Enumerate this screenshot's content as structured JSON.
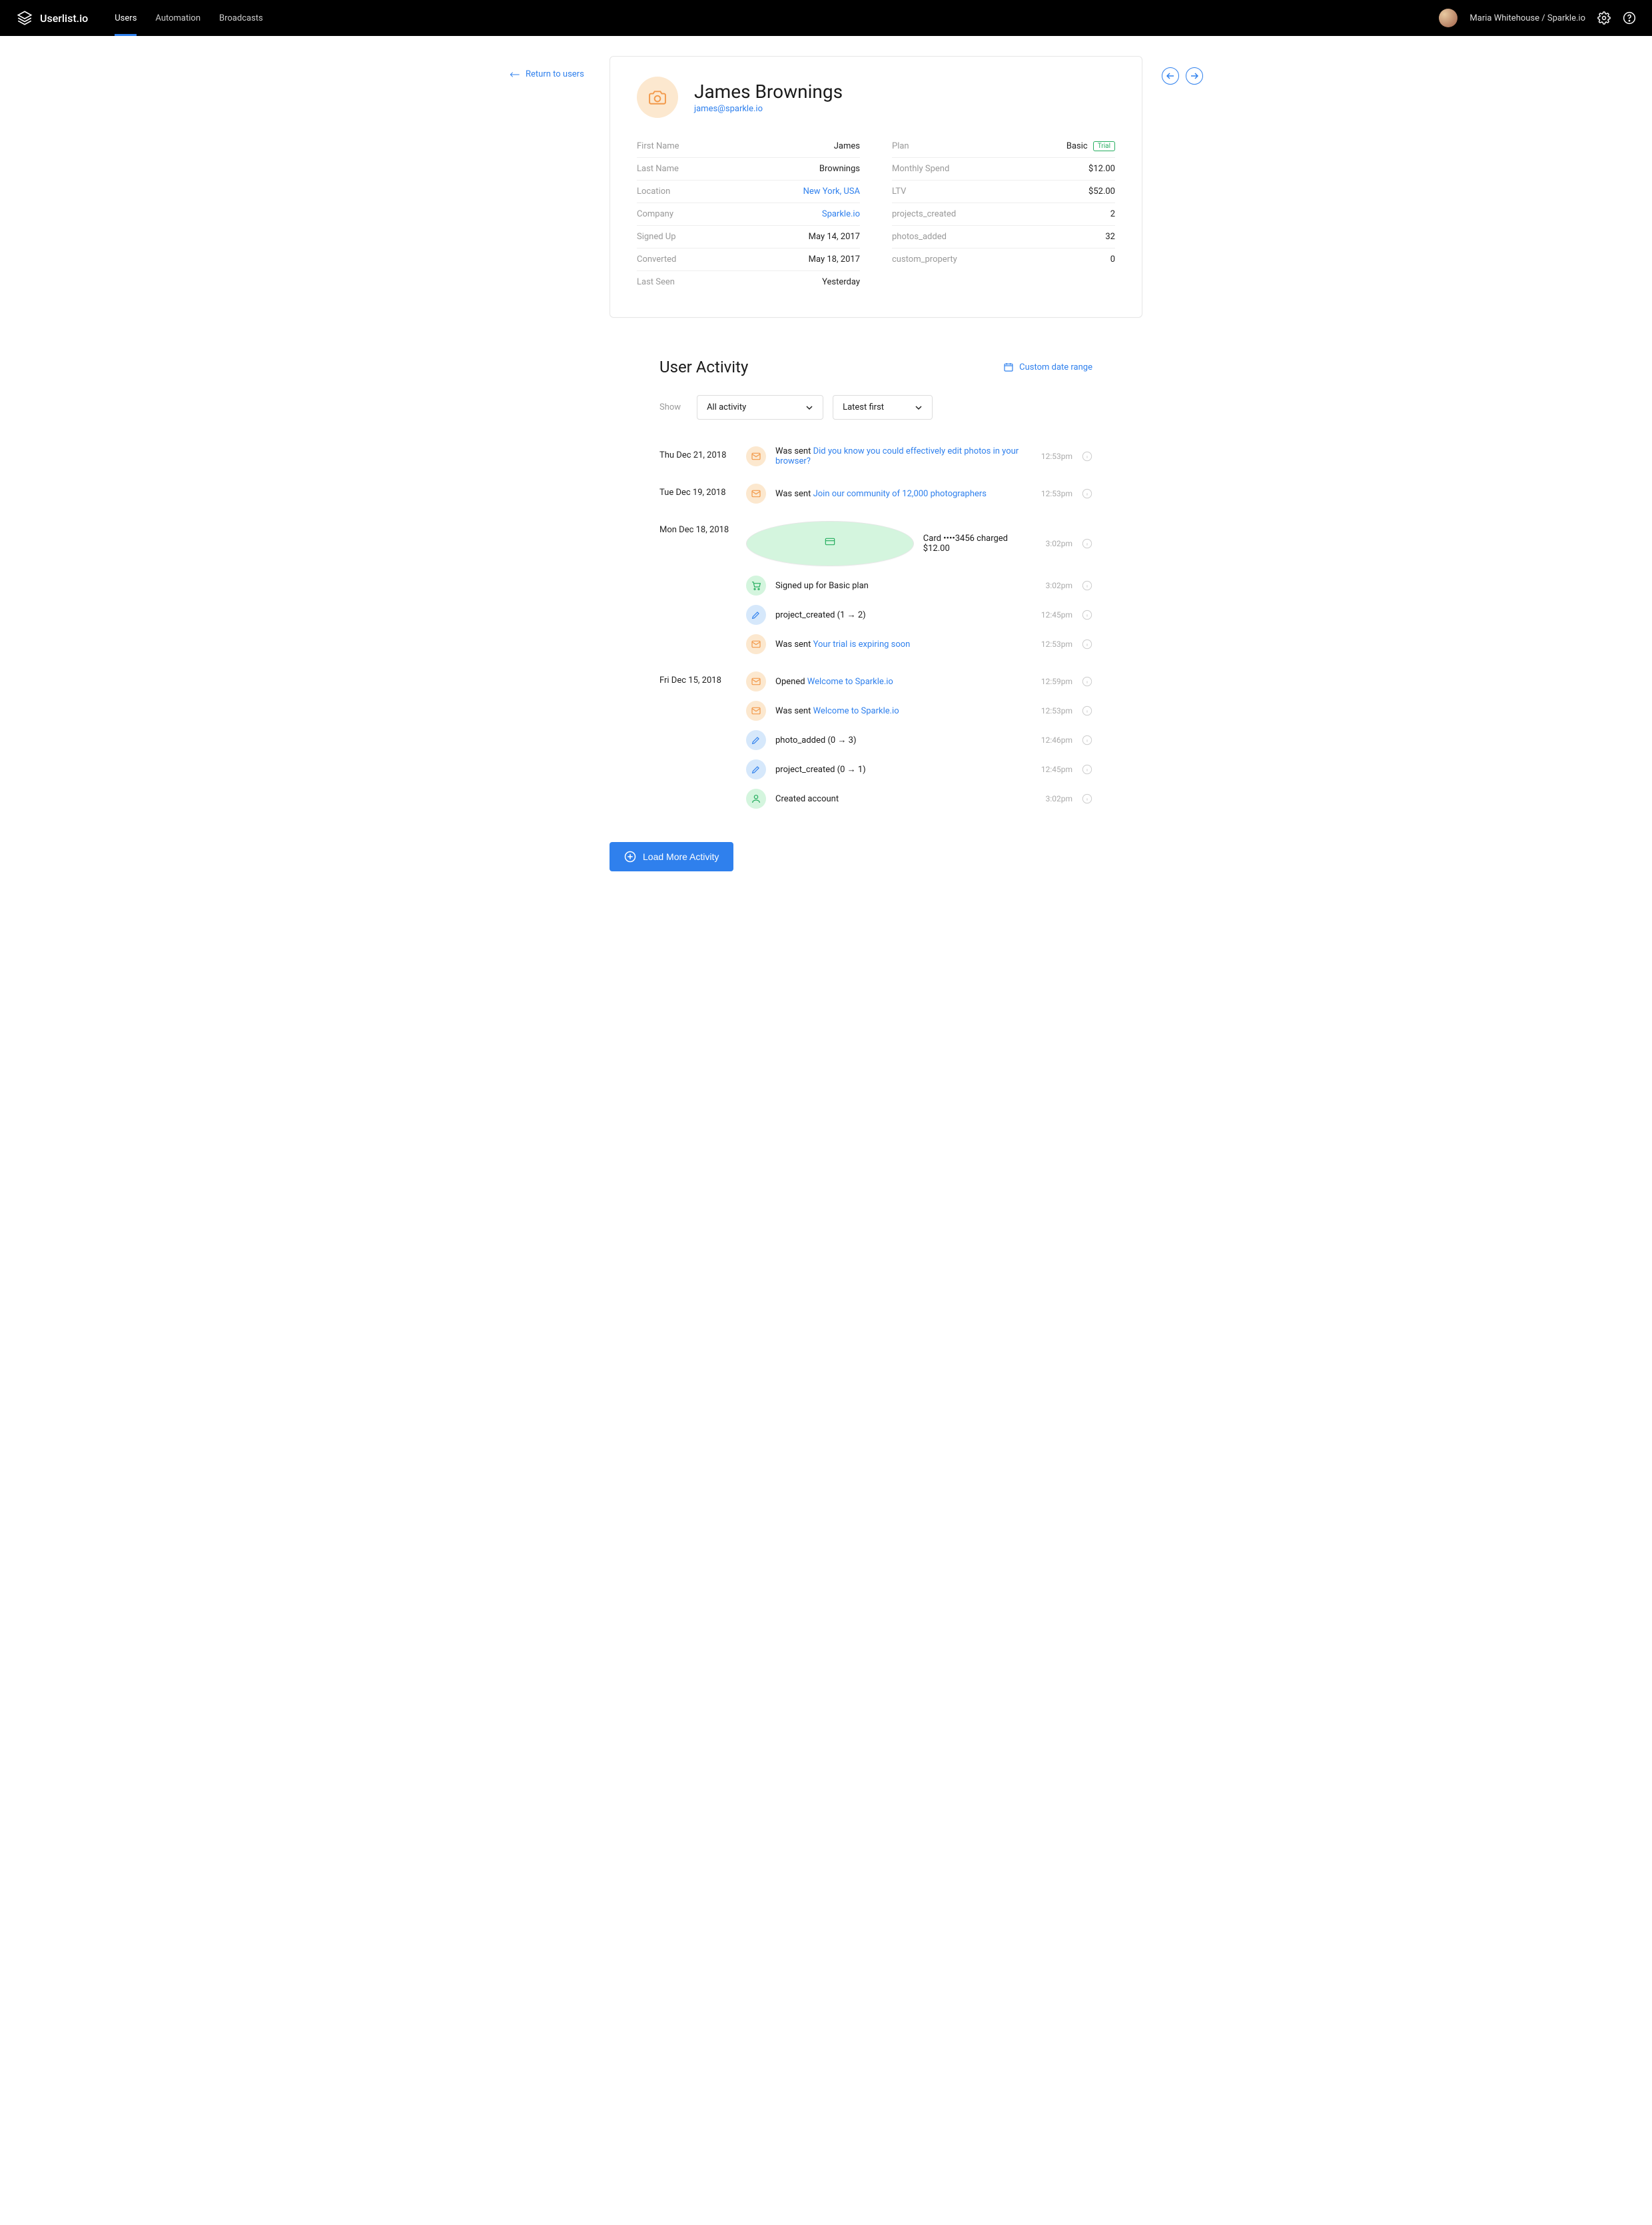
{
  "app": {
    "name": "Userlist.io"
  },
  "nav": {
    "users": "Users",
    "automation": "Automation",
    "broadcasts": "Broadcasts"
  },
  "account": {
    "name": "Maria Whitehouse / Sparkle.io"
  },
  "return_link": "Return to users",
  "profile": {
    "name": "James Brownings",
    "email": "james@sparkle.io",
    "left": {
      "first_name_label": "First Name",
      "first_name_value": "James",
      "last_name_label": "Last Name",
      "last_name_value": "Brownings",
      "location_label": "Location",
      "location_value": "New York, USA",
      "company_label": "Company",
      "company_value": "Sparkle.io",
      "signed_up_label": "Signed Up",
      "signed_up_value": "May 14, 2017",
      "converted_label": "Converted",
      "converted_value": "May 18, 2017",
      "last_seen_label": "Last Seen",
      "last_seen_value": "Yesterday"
    },
    "right": {
      "plan_label": "Plan",
      "plan_value": "Basic",
      "plan_badge": "Trial",
      "monthly_spend_label": "Monthly Spend",
      "monthly_spend_value": "$12.00",
      "ltv_label": "LTV",
      "ltv_value": "$52.00",
      "projects_created_label": "projects_created",
      "projects_created_value": "2",
      "photos_added_label": "photos_added",
      "photos_added_value": "32",
      "custom_property_label": "custom_property",
      "custom_property_value": "0"
    }
  },
  "activity": {
    "title": "User Activity",
    "date_range": "Custom date range",
    "show_label": "Show",
    "filter_type": "All activity",
    "filter_order": "Latest first",
    "days": [
      {
        "date": "Thu Dec 21, 2018",
        "events": [
          {
            "icon": "mail",
            "prefix": "Was sent",
            "link": "Did you know you could effectively edit photos in your browser?",
            "time": "12:53pm"
          }
        ]
      },
      {
        "date": "Tue Dec 19, 2018",
        "events": [
          {
            "icon": "mail",
            "prefix": "Was sent",
            "link": "Join our community of 12,000 photographers",
            "time": "12:53pm"
          }
        ]
      },
      {
        "date": "Mon Dec 18, 2018",
        "events": [
          {
            "icon": "card",
            "text": "Card ••••3456 charged $12.00",
            "time": "3:02pm"
          },
          {
            "icon": "cart",
            "text": "Signed up for Basic plan",
            "time": "3:02pm"
          },
          {
            "icon": "edit",
            "text": "project_created (1 → 2)",
            "time": "12:45pm"
          },
          {
            "icon": "mail",
            "prefix": "Was sent",
            "link": "Your trial is expiring soon",
            "time": "12:53pm"
          }
        ]
      },
      {
        "date": "Fri Dec 15, 2018",
        "events": [
          {
            "icon": "mail",
            "prefix": "Opened",
            "link": "Welcome to Sparkle.io",
            "time": "12:59pm"
          },
          {
            "icon": "mail",
            "prefix": "Was sent",
            "link": "Welcome to Sparkle.io",
            "time": "12:53pm"
          },
          {
            "icon": "edit",
            "text": "photo_added (0 → 3)",
            "time": "12:46pm"
          },
          {
            "icon": "edit",
            "text": "project_created (0 → 1)",
            "time": "12:45pm"
          },
          {
            "icon": "user",
            "text": "Created account",
            "time": "3:02pm"
          }
        ]
      }
    ],
    "load_more": "Load More Activity"
  }
}
